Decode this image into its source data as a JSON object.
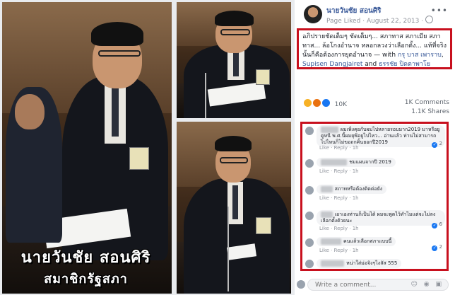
{
  "collage": {
    "caption_name": "นายวันชัย สอนศิริ",
    "caption_title": "สมาชิกรัฐสภา"
  },
  "post": {
    "page_name": "นายวันชัย สอนศิริ",
    "page_type": "Page Liked",
    "separator": "·",
    "date": "August 22, 2013",
    "more_icon": "more-options-icon",
    "text_main": "อภิปรายชัดเต็มๆ ชัดเต็มๆ... สภาทาส สภาเมีย สภาทาส... ล้อโกงอำนาจ หลอกลวงว่าเลือกตั้ง... แท้ที่จริงนั้นก็คือต้องการยุดอำนาจ",
    "text_with": " — with ",
    "tag1": "กรุ บาส เพาราบ",
    "tag_sep": ", ",
    "tag2": "Supisen Dangjairet",
    "tag_and": " and ",
    "tag3": "ธรรชัย ปิดตาพาโย"
  },
  "stats": {
    "reactions_count": "10K",
    "comments": "1K Comments",
    "shares": "1.1K Shares"
  },
  "comments": [
    {
      "text": "ผมเพิ่งคุยกับผมไปหลายรอบมาก2019 มาหรือยูดูหนี พ.ศ.นี้ผมยุพ้อยูไปไหว... อ่านแล้ว ท่านไม่สามารถไปไหนก็ไม่ขอถกคิ้นยอกปี2019",
      "actions": "Like · Reply · 1h",
      "likes": "2"
    },
    {
      "text": "ชมแผนจากปี 2019",
      "actions": "Like · Reply · 1h",
      "likes": ""
    },
    {
      "text": "สภาทหรือต้องติดต่อยัง",
      "actions": "Like · Reply · 1h",
      "likes": ""
    },
    {
      "text": "เอาเองท่านก็เป็นได้ ผมจะพูดไว้ทำไมแต่จะไม่ลงเลือกตั้งด้วยนะ",
      "actions": "Like · Reply · 1h",
      "likes": "6"
    },
    {
      "text": "คนแล้วเลือกสภาแบบนี้",
      "actions": "Like · Reply · 1h",
      "likes": "2"
    },
    {
      "text": "หน่าใส่ม่อจิงๆไงสัส 555",
      "actions": "",
      "likes": ""
    }
  ],
  "composer": {
    "placeholder": "Write a comment...",
    "icons": "☺ ◉ ▣"
  }
}
